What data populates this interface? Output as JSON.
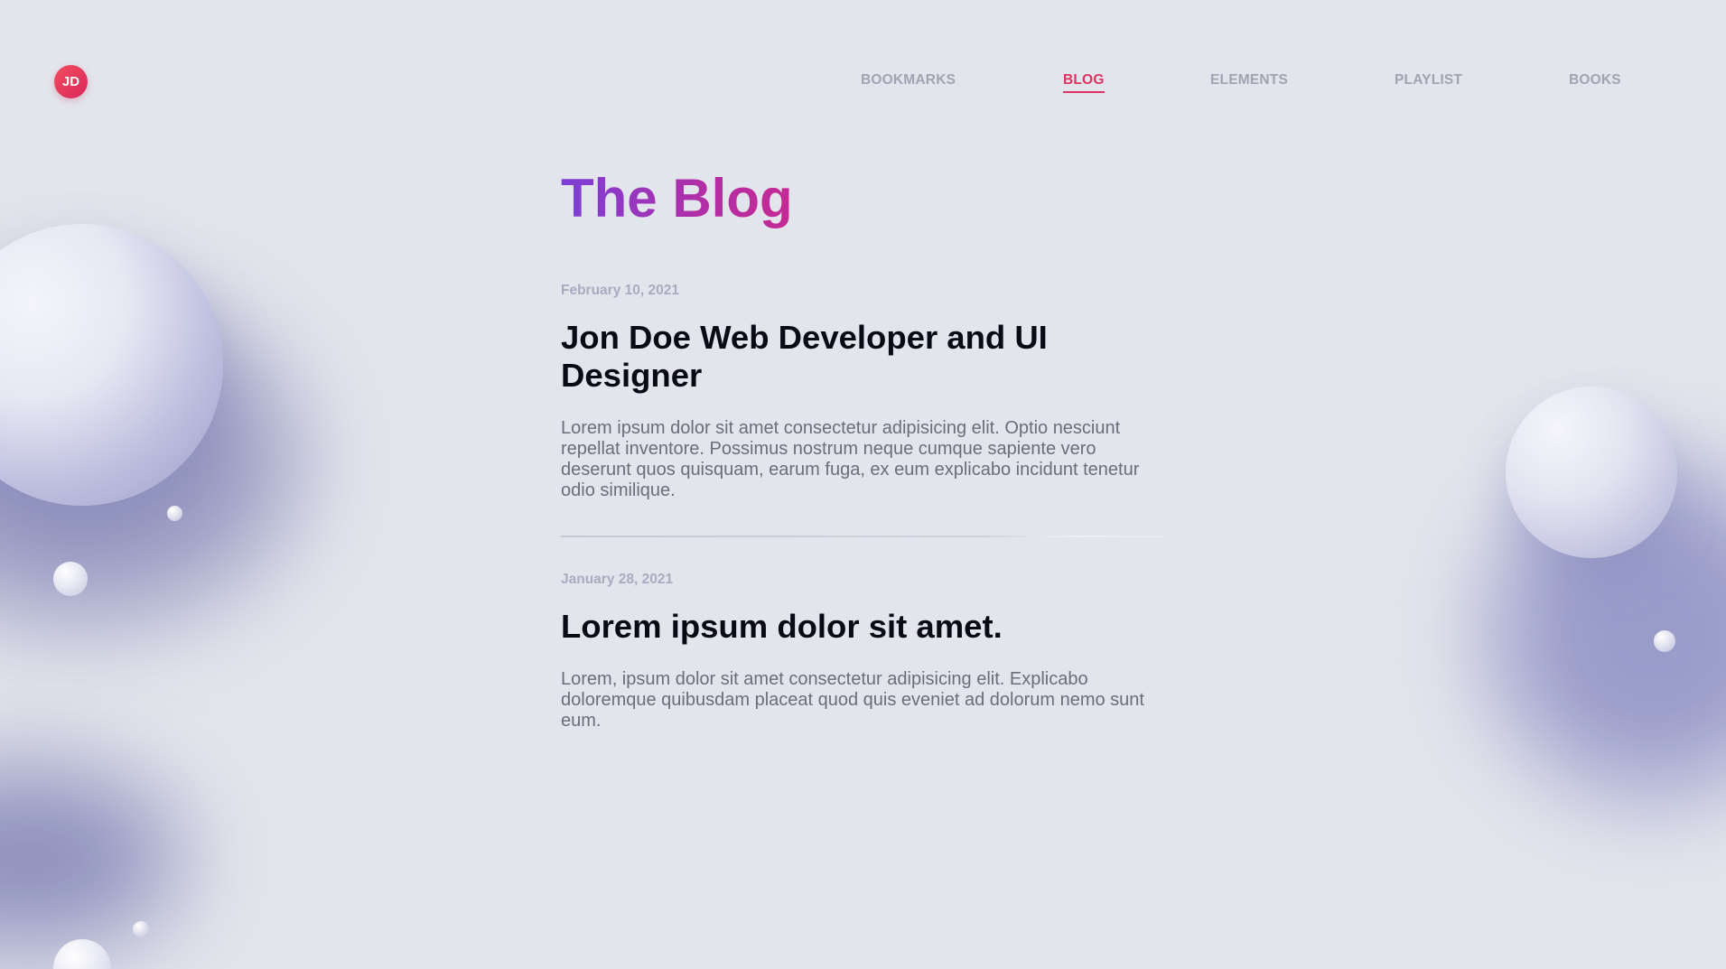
{
  "logo": {
    "initials": "JD"
  },
  "nav": {
    "items": [
      {
        "label": "BOOKMARKS",
        "active": false
      },
      {
        "label": "BLOG",
        "active": true
      },
      {
        "label": "ELEMENTS",
        "active": false
      },
      {
        "label": "PLAYLIST",
        "active": false
      },
      {
        "label": "BOOKS",
        "active": false
      }
    ]
  },
  "page": {
    "title": "The Blog"
  },
  "posts": [
    {
      "date": "February 10, 2021",
      "title": "Jon Doe Web Developer and UI Designer",
      "body": "Lorem ipsum dolor sit amet consectetur adipisicing elit. Optio nesciunt repellat inventore. Possimus nostrum neque cumque sapiente vero deserunt quos quisquam, earum fuga, ex eum explicabo incidunt tenetur odio similique."
    },
    {
      "date": "January 28, 2021",
      "title": "Lorem ipsum dolor sit amet.",
      "body": "Lorem, ipsum dolor sit amet consectetur adipisicing elit. Explicabo doloremque quibusdam placeat quod quis eveniet ad dolorum nemo sunt eum."
    }
  ],
  "colors": {
    "background": "#e3e5ec",
    "accent": "#e0325f",
    "title_gradient_start": "#7b3fd8",
    "title_gradient_end": "#c52993",
    "nav_text": "#a1a3b3",
    "date_text": "#a9abc0",
    "body_text": "#6b6d7a"
  }
}
